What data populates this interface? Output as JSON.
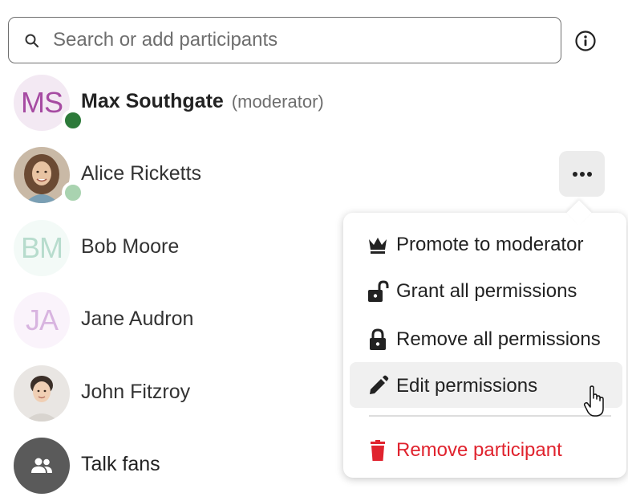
{
  "search": {
    "placeholder": "Search or add participants",
    "value": ""
  },
  "participants": [
    {
      "initials": "MS",
      "name": "Max Southgate",
      "role": "(moderator)",
      "status_color": "#2d7a3a",
      "avatar_color": "#a64ba2",
      "avatar_bg": "#f3e9f3"
    },
    {
      "initials": "",
      "name": "Alice Ricketts",
      "role": "",
      "status_color": "#a9d3b0"
    },
    {
      "initials": "BM",
      "name": "Bob Moore",
      "role": "",
      "avatar_color": "#b7dccd",
      "avatar_bg": "#f3faf7"
    },
    {
      "initials": "JA",
      "name": "Jane Audron",
      "role": "",
      "avatar_color": "#d8b4e0",
      "avatar_bg": "#faf3fb"
    },
    {
      "initials": "",
      "name": "John Fitzroy",
      "role": ""
    },
    {
      "initials": "",
      "name": "Talk fans",
      "role": ""
    }
  ],
  "menu": {
    "items": [
      {
        "label": "Promote to moderator",
        "icon": "crown-icon"
      },
      {
        "label": "Grant all permissions",
        "icon": "lock-open-icon"
      },
      {
        "label": "Remove all permissions",
        "icon": "lock-icon"
      },
      {
        "label": "Edit permissions",
        "icon": "pencil-icon"
      }
    ],
    "danger_item": {
      "label": "Remove participant",
      "icon": "trash-icon"
    }
  },
  "colors": {
    "danger": "#e0232e",
    "online": "#2d7a3a",
    "away": "#a9d3b0",
    "hover": "#f0f0f0"
  }
}
